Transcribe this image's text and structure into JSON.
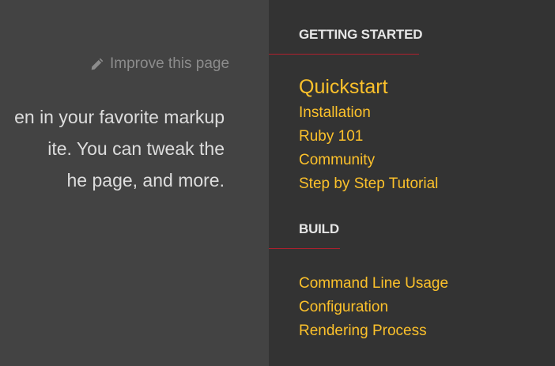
{
  "main": {
    "improve_link": "Improve this page",
    "body_lines": [
      "en in your favorite markup",
      "ite. You can tweak the",
      "he page, and more."
    ]
  },
  "sidebar": {
    "sections": [
      {
        "title": "GETTING STARTED",
        "items": [
          {
            "label": "Quickstart",
            "current": true
          },
          {
            "label": "Installation"
          },
          {
            "label": "Ruby 101"
          },
          {
            "label": "Community"
          },
          {
            "label": "Step by Step Tutorial"
          }
        ]
      },
      {
        "title": "BUILD",
        "items": [
          {
            "label": "Command Line Usage"
          },
          {
            "label": "Configuration"
          },
          {
            "label": "Rendering Process"
          }
        ]
      }
    ]
  },
  "colors": {
    "main_bg": "#434343",
    "sidebar_bg": "#333333",
    "accent_link": "#fcc12b",
    "rule_red": "#b0202e"
  },
  "icons": {
    "improve": "pencil-icon"
  }
}
